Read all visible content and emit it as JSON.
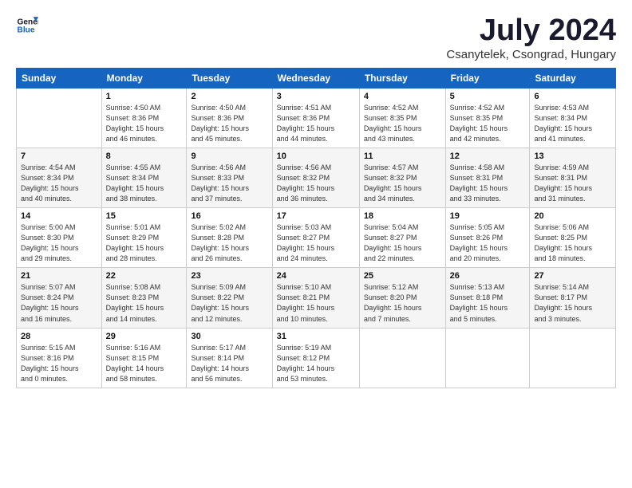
{
  "logo": {
    "line1": "General",
    "line2": "Blue"
  },
  "title": "July 2024",
  "location": "Csanytelek, Csongrad, Hungary",
  "days_header": [
    "Sunday",
    "Monday",
    "Tuesday",
    "Wednesday",
    "Thursday",
    "Friday",
    "Saturday"
  ],
  "weeks": [
    [
      {
        "day": "",
        "info": ""
      },
      {
        "day": "1",
        "info": "Sunrise: 4:50 AM\nSunset: 8:36 PM\nDaylight: 15 hours\nand 46 minutes."
      },
      {
        "day": "2",
        "info": "Sunrise: 4:50 AM\nSunset: 8:36 PM\nDaylight: 15 hours\nand 45 minutes."
      },
      {
        "day": "3",
        "info": "Sunrise: 4:51 AM\nSunset: 8:36 PM\nDaylight: 15 hours\nand 44 minutes."
      },
      {
        "day": "4",
        "info": "Sunrise: 4:52 AM\nSunset: 8:35 PM\nDaylight: 15 hours\nand 43 minutes."
      },
      {
        "day": "5",
        "info": "Sunrise: 4:52 AM\nSunset: 8:35 PM\nDaylight: 15 hours\nand 42 minutes."
      },
      {
        "day": "6",
        "info": "Sunrise: 4:53 AM\nSunset: 8:34 PM\nDaylight: 15 hours\nand 41 minutes."
      }
    ],
    [
      {
        "day": "7",
        "info": "Sunrise: 4:54 AM\nSunset: 8:34 PM\nDaylight: 15 hours\nand 40 minutes."
      },
      {
        "day": "8",
        "info": "Sunrise: 4:55 AM\nSunset: 8:34 PM\nDaylight: 15 hours\nand 38 minutes."
      },
      {
        "day": "9",
        "info": "Sunrise: 4:56 AM\nSunset: 8:33 PM\nDaylight: 15 hours\nand 37 minutes."
      },
      {
        "day": "10",
        "info": "Sunrise: 4:56 AM\nSunset: 8:32 PM\nDaylight: 15 hours\nand 36 minutes."
      },
      {
        "day": "11",
        "info": "Sunrise: 4:57 AM\nSunset: 8:32 PM\nDaylight: 15 hours\nand 34 minutes."
      },
      {
        "day": "12",
        "info": "Sunrise: 4:58 AM\nSunset: 8:31 PM\nDaylight: 15 hours\nand 33 minutes."
      },
      {
        "day": "13",
        "info": "Sunrise: 4:59 AM\nSunset: 8:31 PM\nDaylight: 15 hours\nand 31 minutes."
      }
    ],
    [
      {
        "day": "14",
        "info": "Sunrise: 5:00 AM\nSunset: 8:30 PM\nDaylight: 15 hours\nand 29 minutes."
      },
      {
        "day": "15",
        "info": "Sunrise: 5:01 AM\nSunset: 8:29 PM\nDaylight: 15 hours\nand 28 minutes."
      },
      {
        "day": "16",
        "info": "Sunrise: 5:02 AM\nSunset: 8:28 PM\nDaylight: 15 hours\nand 26 minutes."
      },
      {
        "day": "17",
        "info": "Sunrise: 5:03 AM\nSunset: 8:27 PM\nDaylight: 15 hours\nand 24 minutes."
      },
      {
        "day": "18",
        "info": "Sunrise: 5:04 AM\nSunset: 8:27 PM\nDaylight: 15 hours\nand 22 minutes."
      },
      {
        "day": "19",
        "info": "Sunrise: 5:05 AM\nSunset: 8:26 PM\nDaylight: 15 hours\nand 20 minutes."
      },
      {
        "day": "20",
        "info": "Sunrise: 5:06 AM\nSunset: 8:25 PM\nDaylight: 15 hours\nand 18 minutes."
      }
    ],
    [
      {
        "day": "21",
        "info": "Sunrise: 5:07 AM\nSunset: 8:24 PM\nDaylight: 15 hours\nand 16 minutes."
      },
      {
        "day": "22",
        "info": "Sunrise: 5:08 AM\nSunset: 8:23 PM\nDaylight: 15 hours\nand 14 minutes."
      },
      {
        "day": "23",
        "info": "Sunrise: 5:09 AM\nSunset: 8:22 PM\nDaylight: 15 hours\nand 12 minutes."
      },
      {
        "day": "24",
        "info": "Sunrise: 5:10 AM\nSunset: 8:21 PM\nDaylight: 15 hours\nand 10 minutes."
      },
      {
        "day": "25",
        "info": "Sunrise: 5:12 AM\nSunset: 8:20 PM\nDaylight: 15 hours\nand 7 minutes."
      },
      {
        "day": "26",
        "info": "Sunrise: 5:13 AM\nSunset: 8:18 PM\nDaylight: 15 hours\nand 5 minutes."
      },
      {
        "day": "27",
        "info": "Sunrise: 5:14 AM\nSunset: 8:17 PM\nDaylight: 15 hours\nand 3 minutes."
      }
    ],
    [
      {
        "day": "28",
        "info": "Sunrise: 5:15 AM\nSunset: 8:16 PM\nDaylight: 15 hours\nand 0 minutes."
      },
      {
        "day": "29",
        "info": "Sunrise: 5:16 AM\nSunset: 8:15 PM\nDaylight: 14 hours\nand 58 minutes."
      },
      {
        "day": "30",
        "info": "Sunrise: 5:17 AM\nSunset: 8:14 PM\nDaylight: 14 hours\nand 56 minutes."
      },
      {
        "day": "31",
        "info": "Sunrise: 5:19 AM\nSunset: 8:12 PM\nDaylight: 14 hours\nand 53 minutes."
      },
      {
        "day": "",
        "info": ""
      },
      {
        "day": "",
        "info": ""
      },
      {
        "day": "",
        "info": ""
      }
    ]
  ]
}
